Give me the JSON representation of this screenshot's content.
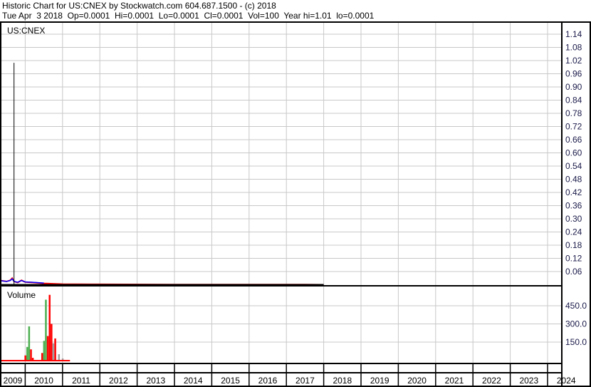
{
  "header": {
    "title_line": "Historic Chart for US:CNEX by Stockwatch.com 604.687.1500 - (c) 2018",
    "quote_line": "Tue Apr  3 2018  Op=0.0001  Hi=0.0001  Lo=0.0001  Cl=0.0001  Vol=100  Year hi=1.01  lo=0.0001"
  },
  "chart_data": [
    {
      "type": "line",
      "title": "US:CNEX",
      "ylim": [
        0,
        1.17
      ],
      "yticks": [
        "0.06",
        "0.12",
        "0.18",
        "0.24",
        "0.30",
        "0.36",
        "0.42",
        "0.48",
        "0.54",
        "0.60",
        "0.66",
        "0.72",
        "0.78",
        "0.84",
        "0.90",
        "0.96",
        "1.02",
        "1.08",
        "1.14"
      ],
      "x": [
        2009.3,
        2009.5,
        2009.6,
        2009.65,
        2009.7,
        2009.8,
        2009.9,
        2010.0,
        2010.2,
        2010.5,
        2011.0,
        2012.0,
        2014.0,
        2016.0,
        2017.5,
        2018.0
      ],
      "close": [
        0.02,
        0.015,
        0.02,
        0.03,
        0.015,
        0.01,
        0.02,
        0.012,
        0.01,
        0.006,
        0.003,
        0.002,
        0.001,
        0.001,
        0.0008,
        0.0001
      ],
      "high_spike": {
        "x": 2009.7,
        "value": 1.01
      },
      "grid": true,
      "legend": "none"
    },
    {
      "type": "bar",
      "title": "Volume",
      "ylim": [
        0,
        540
      ],
      "yticks": [
        "150.0",
        "300.0",
        "450.0"
      ],
      "x": [
        2010.0,
        2010.05,
        2010.1,
        2010.15,
        2010.2,
        2010.45,
        2010.5,
        2010.55,
        2010.6,
        2010.65,
        2010.7,
        2010.75,
        2010.8,
        2010.9,
        2011.0
      ],
      "values": [
        40,
        110,
        280,
        90,
        20,
        60,
        160,
        500,
        200,
        540,
        300,
        140,
        180,
        50,
        15
      ],
      "colors": [
        "red",
        "green",
        "green",
        "red",
        "red",
        "red",
        "green",
        "green",
        "red",
        "red",
        "red",
        "gray",
        "red",
        "gray",
        "gray"
      ]
    }
  ],
  "x_axis": {
    "years": [
      "2009",
      "2010",
      "2011",
      "2012",
      "2013",
      "2014",
      "2015",
      "2016",
      "2017",
      "2018",
      "2019",
      "2020",
      "2021",
      "2022",
      "2023",
      "2024"
    ]
  },
  "colors": {
    "up": "#4caf50",
    "down": "#ff0000",
    "flat": "#a0a0a0",
    "grid": "#c8c8c8",
    "ma1": "#0000ff",
    "ma2": "#ff00ff",
    "text_axis": "#1a1a4a"
  }
}
